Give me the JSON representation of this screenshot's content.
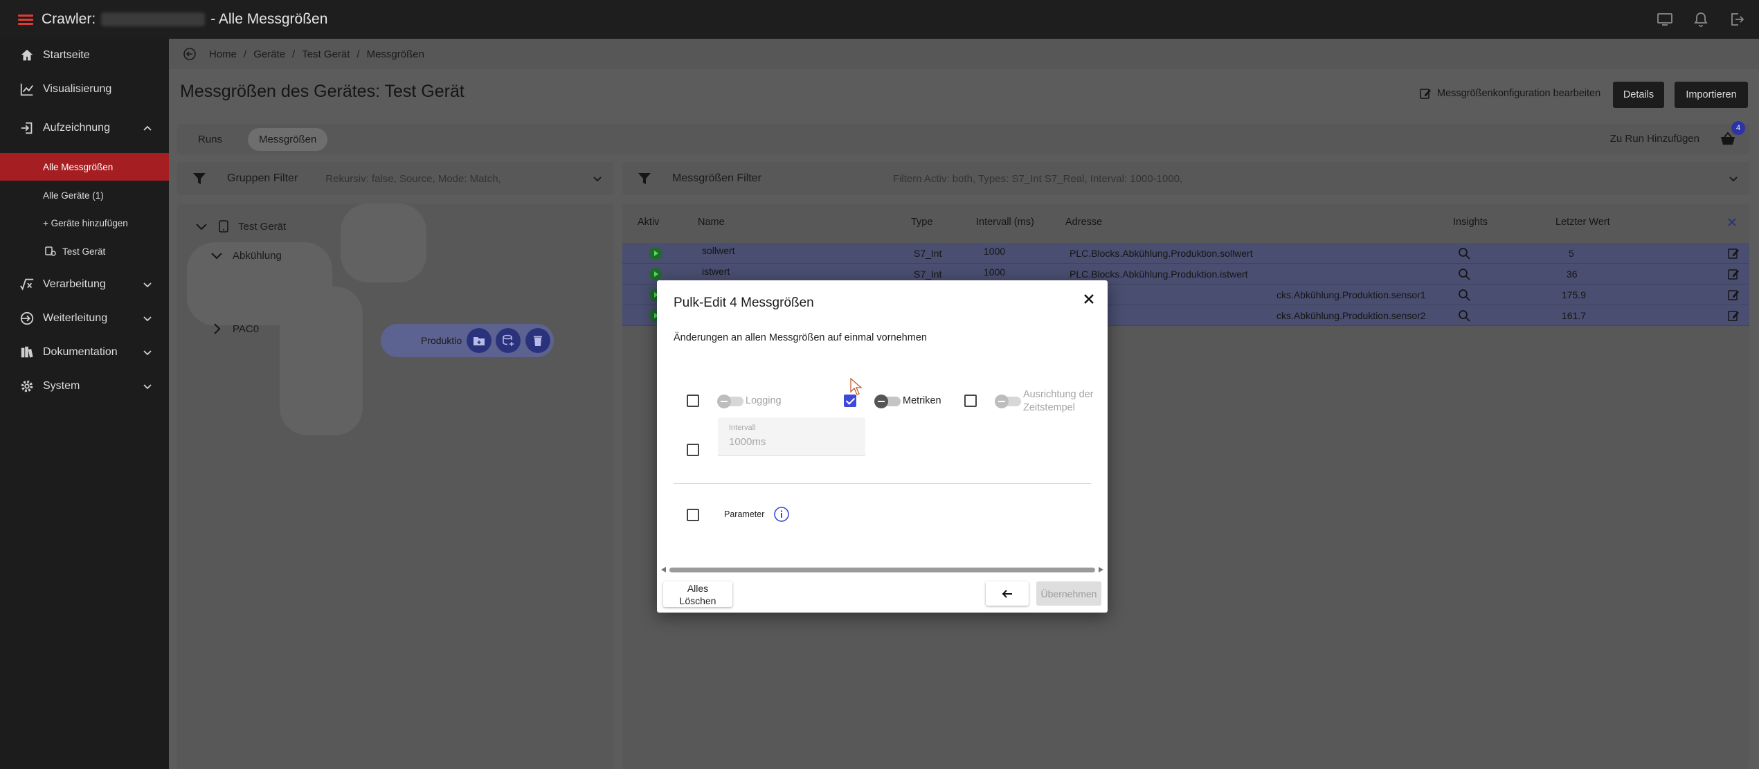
{
  "topbar": {
    "title_prefix": "Crawler:",
    "title_suffix": "- Alle Messgrößen",
    "icons": [
      "monitor-icon",
      "bell-icon",
      "logout-icon"
    ],
    "accent_color": "#e53935"
  },
  "sidebar": {
    "items": [
      {
        "label": "Startseite",
        "icon": "home-icon"
      },
      {
        "label": "Visualisierung",
        "icon": "chart-line-icon"
      },
      {
        "label": "Aufzeichnung",
        "icon": "login-icon",
        "expanded": true
      },
      {
        "label": "Verarbeitung",
        "icon": "function-icon"
      },
      {
        "label": "Weiterleitung",
        "icon": "forward-icon"
      },
      {
        "label": "Dokumentation",
        "icon": "book-icon"
      },
      {
        "label": "System",
        "icon": "gear-icon"
      }
    ],
    "subitems": [
      {
        "label": "Alle Messgrößen",
        "active": true
      },
      {
        "label": "Alle Geräte (1)"
      },
      {
        "label": "+ Geräte hinzufügen"
      },
      {
        "label": "Test Gerät"
      }
    ],
    "active_color": "#a51e22"
  },
  "breadcrumb": [
    "Home",
    "Geräte",
    "Test Gerät",
    "Messgrößen"
  ],
  "page": {
    "title": "Messgrößen des Gerätes: Test Gerät",
    "edit_config_label": "Messgrößenkonfiguration bearbeiten",
    "details_label": "Details",
    "import_label": "Importieren"
  },
  "tabs": {
    "items": [
      "Runs",
      "Messgrößen"
    ],
    "selected": "Messgrößen",
    "add_to_run_label": "Zu Run Hinzufügen",
    "basket_count": "4"
  },
  "group_filter": {
    "title": "Gruppen Filter",
    "summary": "Rekursiv: false, Source, Mode: Match,"
  },
  "measure_filter": {
    "title": "Messgrößen Filter",
    "summary": "Filtern Activ: both, Types: S7_Int S7_Real, Interval: 1000-1000,"
  },
  "tree": {
    "root": "Test Gerät",
    "child": "Abkühlung",
    "selected_node": "Produktion",
    "other": "PAC0"
  },
  "table": {
    "columns": [
      "Aktiv",
      "Name",
      "Type",
      "Intervall (ms)",
      "Adresse",
      "Insights",
      "Letzter Wert"
    ],
    "rows": [
      {
        "name": "sollwert",
        "type": "S7_Int",
        "interval": "1000",
        "address": "PLC.Blocks.Abkühlung.Produktion.sollwert",
        "value": "5"
      },
      {
        "name": "istwert",
        "type": "S7_Int",
        "interval": "1000",
        "address": "PLC.Blocks.Abkühlung.Produktion.istwert",
        "value": "36"
      },
      {
        "name": "",
        "type": "",
        "interval": "",
        "address": "cks.Abkühlung.Produktion.sensor1",
        "value": "175.9"
      },
      {
        "name": "",
        "type": "",
        "interval": "",
        "address": "cks.Abkühlung.Produktion.sensor2",
        "value": "161.7"
      }
    ]
  },
  "dialog": {
    "title": "Pulk-Edit 4 Messgrößen",
    "subtitle": "Änderungen an allen Messgrößen auf einmal vornehmen",
    "logging_label": "Logging",
    "logging_checked": false,
    "metrics_label": "Metriken",
    "metrics_checked": true,
    "timestamp_label_line1": "Ausrichtung der",
    "timestamp_label_line2": "Zeitstempel",
    "timestamp_checked": false,
    "interval_label": "Intervall",
    "interval_value": "1000ms",
    "interval_checked": false,
    "parameter_label": "Parameter",
    "parameter_checked": false,
    "clear_label_line1": "Alles",
    "clear_label_line2": "Löschen",
    "apply_label": "Übernehmen",
    "checkbox_color": "#3d49d8"
  }
}
